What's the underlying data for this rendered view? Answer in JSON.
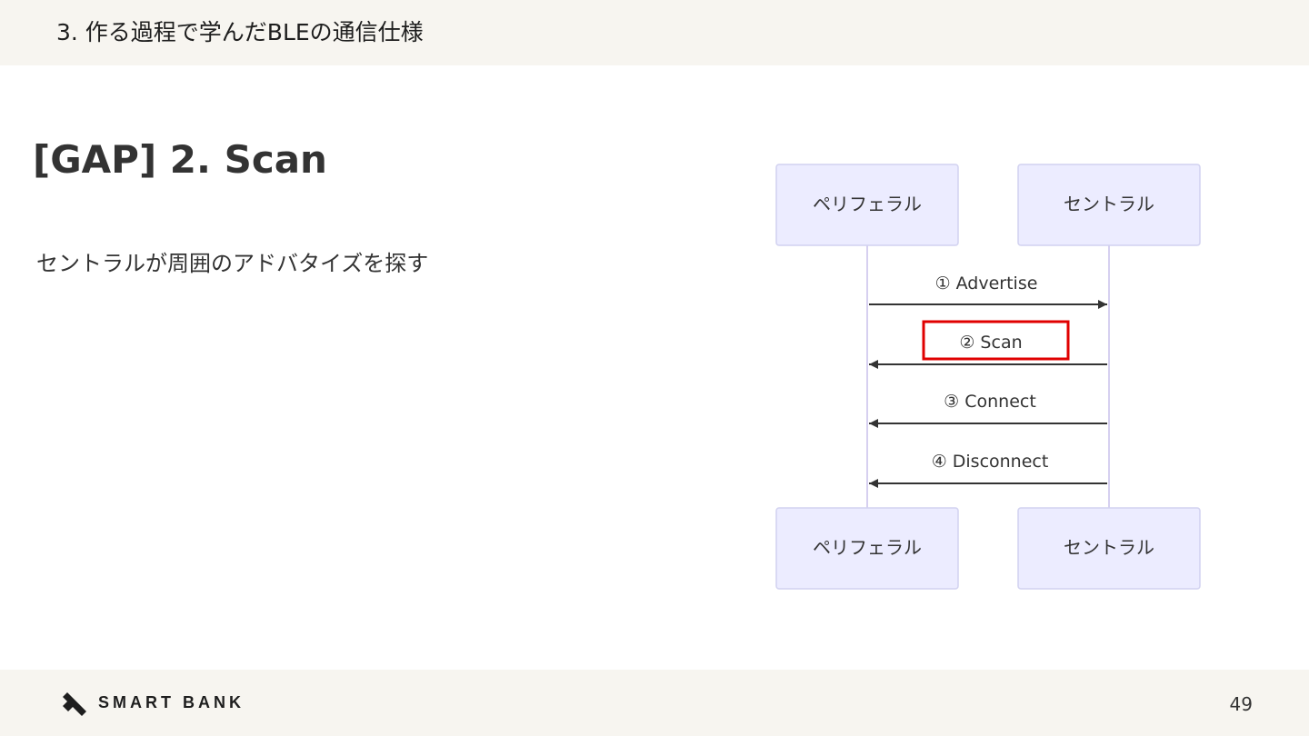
{
  "header": {
    "title": "3. 作る過程で学んだBLEの通信仕様"
  },
  "slide": {
    "title": "[GAP] 2. Scan",
    "body": "セントラルが周囲のアドバタイズを探す"
  },
  "diagram": {
    "participants": {
      "left": "ペリフェラル",
      "right": "セントラル"
    },
    "messages": [
      {
        "label": "① Advertise",
        "direction": "left-to-right",
        "highlighted": false
      },
      {
        "label": "② Scan",
        "direction": "right-to-left",
        "highlighted": true
      },
      {
        "label": "③ Connect",
        "direction": "right-to-left",
        "highlighted": false
      },
      {
        "label": "④ Disconnect",
        "direction": "right-to-left",
        "highlighted": false
      }
    ],
    "colors": {
      "participant_fill": "#ececff",
      "participant_stroke": "#d2d2f0",
      "lifeline": "#d6d0f0",
      "arrow": "#333333",
      "highlight": "#e00000"
    }
  },
  "footer": {
    "logo_text": "SMART BANK",
    "logo_icon": "smartbank-logo-mark",
    "page_number": "49"
  }
}
